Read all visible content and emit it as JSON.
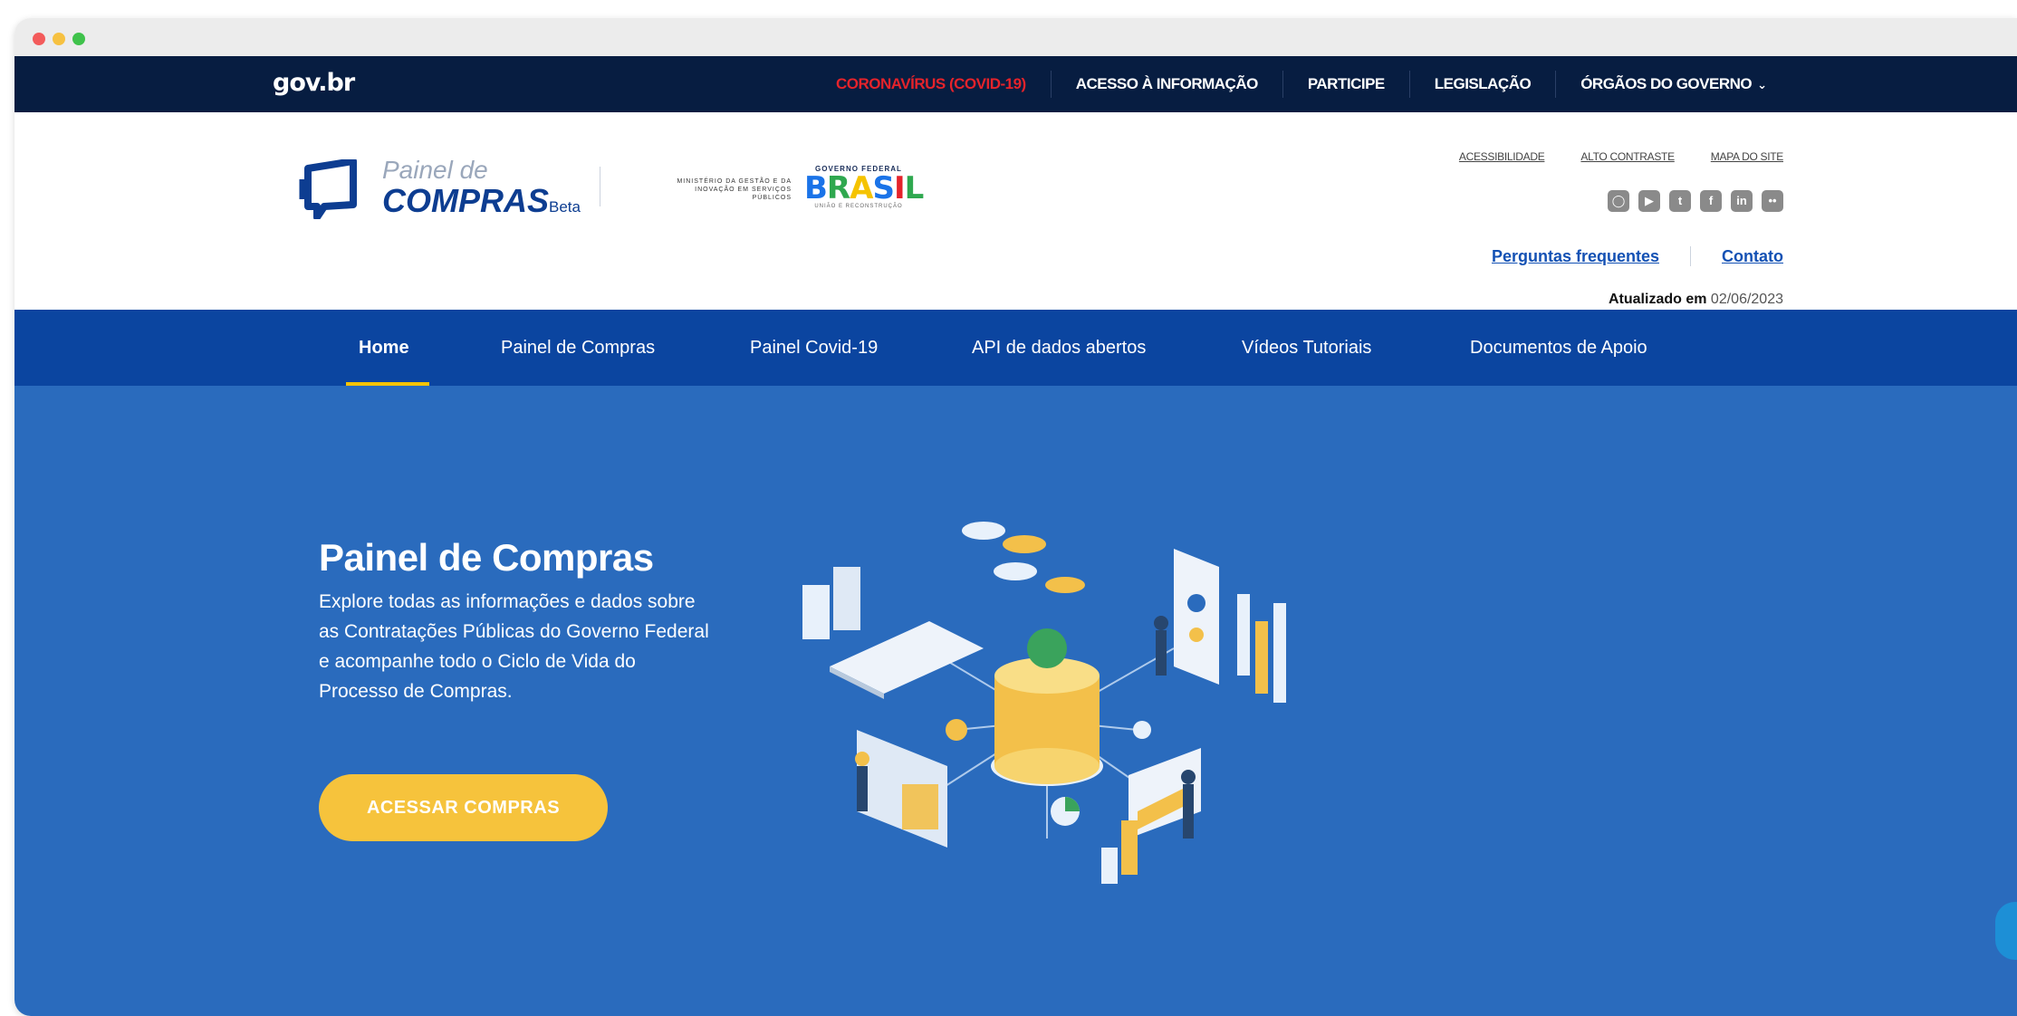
{
  "govbar": {
    "logo": "gov.br",
    "links": [
      {
        "label": "CORONAVÍRUS (COVID-19)",
        "name": "govbar-link-covid"
      },
      {
        "label": "ACESSO À INFORMAÇÃO",
        "name": "govbar-link-acesso"
      },
      {
        "label": "PARTICIPE",
        "name": "govbar-link-participe"
      },
      {
        "label": "LEGISLAÇÃO",
        "name": "govbar-link-legislacao"
      },
      {
        "label": "ÓRGÃOS DO GOVERNO",
        "name": "govbar-link-orgaos"
      }
    ]
  },
  "header": {
    "logo_line1": "Painel de",
    "logo_line2": "COMPRAS",
    "logo_beta": "Beta",
    "ministry": "MINISTÉRIO DA GESTÃO E DA INOVAÇÃO EM SERVIÇOS PÚBLICOS",
    "gov_federal": "GOVERNO FEDERAL",
    "brasil": "BRASIL",
    "gov_sub": "UNIÃO E RECONSTRUÇÃO",
    "accessibility_links": [
      "ACESSIBILIDADE",
      "ALTO CONTRASTE",
      "MAPA DO SITE"
    ],
    "social_icons": [
      "instagram-icon",
      "youtube-icon",
      "twitter-icon",
      "facebook-icon",
      "linkedin-icon",
      "flickr-icon"
    ],
    "faq_label": "Perguntas frequentes",
    "contact_label": "Contato",
    "updated_label": "Atualizado em",
    "updated_date": "02/06/2023"
  },
  "nav": {
    "items": [
      "Home",
      "Painel de Compras",
      "Painel Covid-19",
      "API de dados abertos",
      "Vídeos Tutoriais",
      "Documentos de Apoio"
    ],
    "active": "Home"
  },
  "hero": {
    "title": "Painel de Compras",
    "description": "Explore todas as informações e dados sobre as Contratações Públicas do Governo Federal e acompanhe todo o Ciclo de Vida do Processo de Compras.",
    "button_label": "ACESSAR COMPRAS"
  },
  "colors": {
    "govbar_bg": "#071d41",
    "nav_bg": "#0b45a0",
    "hero_bg": "#2a6bbd",
    "accent_yellow": "#f6c33c",
    "covid_red": "#e5232b",
    "link_blue": "#1351b4"
  }
}
